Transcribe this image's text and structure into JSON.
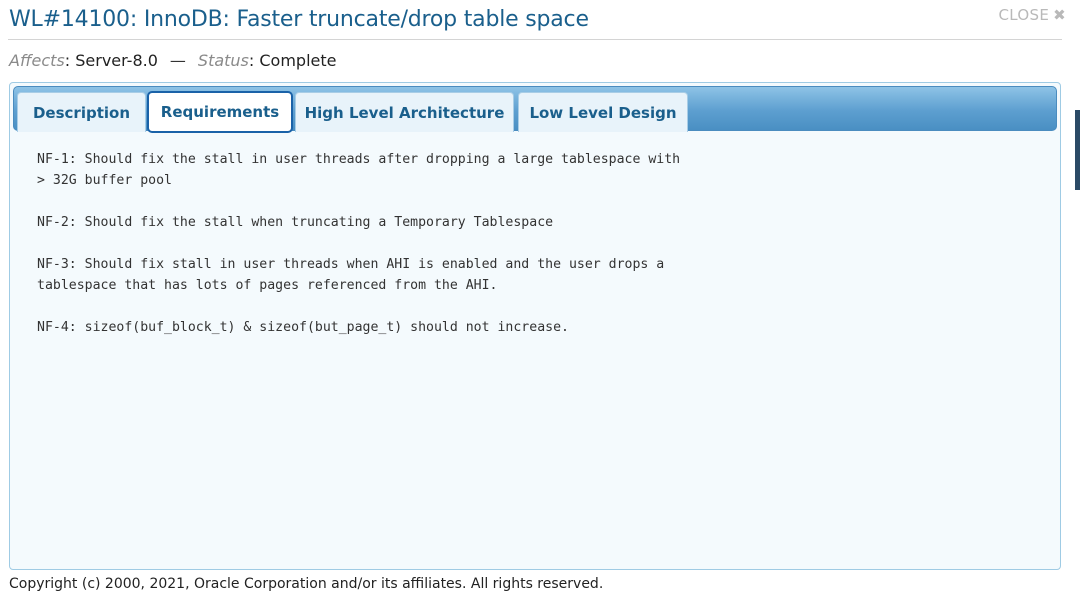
{
  "header": {
    "title": "WL#14100: InnoDB: Faster truncate/drop table space",
    "close_label": "CLOSE",
    "close_glyph": "✖"
  },
  "meta": {
    "affects_label": "Affects",
    "affects_value": "Server-8.0",
    "separator": "—",
    "status_label": "Status",
    "status_value": "Complete"
  },
  "tabs": [
    {
      "label": "Description",
      "active": false
    },
    {
      "label": "Requirements",
      "active": true
    },
    {
      "label": "High Level Architecture",
      "active": false
    },
    {
      "label": "Low Level Design",
      "active": false
    }
  ],
  "requirements": [
    "NF-1: Should fix the stall in user threads after dropping a large tablespace with\n> 32G buffer pool",
    "NF-2: Should fix the stall when truncating a Temporary Tablespace",
    "NF-3: Should fix stall in user threads when AHI is enabled and the user drops a\ntablespace that has lots of pages referenced from the AHI.",
    "NF-4: sizeof(buf_block_t) & sizeof(but_page_t) should not increase."
  ],
  "footer": {
    "copyright": "Copyright (c) 2000, 2021, Oracle Corporation and/or its affiliates. All rights reserved."
  },
  "colors": {
    "title": "#1a5f8c",
    "tab_text": "#1a5f8c",
    "active_tab_border": "#1a62a8",
    "tabbar": "#5d9fd0"
  }
}
